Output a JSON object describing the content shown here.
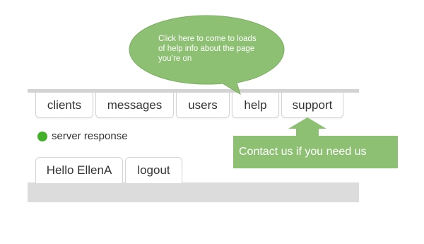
{
  "nav": {
    "tabs": [
      {
        "label": "clients"
      },
      {
        "label": "messages"
      },
      {
        "label": "users"
      },
      {
        "label": "help"
      },
      {
        "label": "support"
      }
    ]
  },
  "status": {
    "label": "server response",
    "color": "#43b02a"
  },
  "user": {
    "greeting": "Hello EllenA",
    "logout_label": "logout"
  },
  "callouts": {
    "help_bubble": "Click here to come to loads of help info about the page you’re on",
    "support_arrow": "Contact us if you need us",
    "color": "#8dc073"
  }
}
